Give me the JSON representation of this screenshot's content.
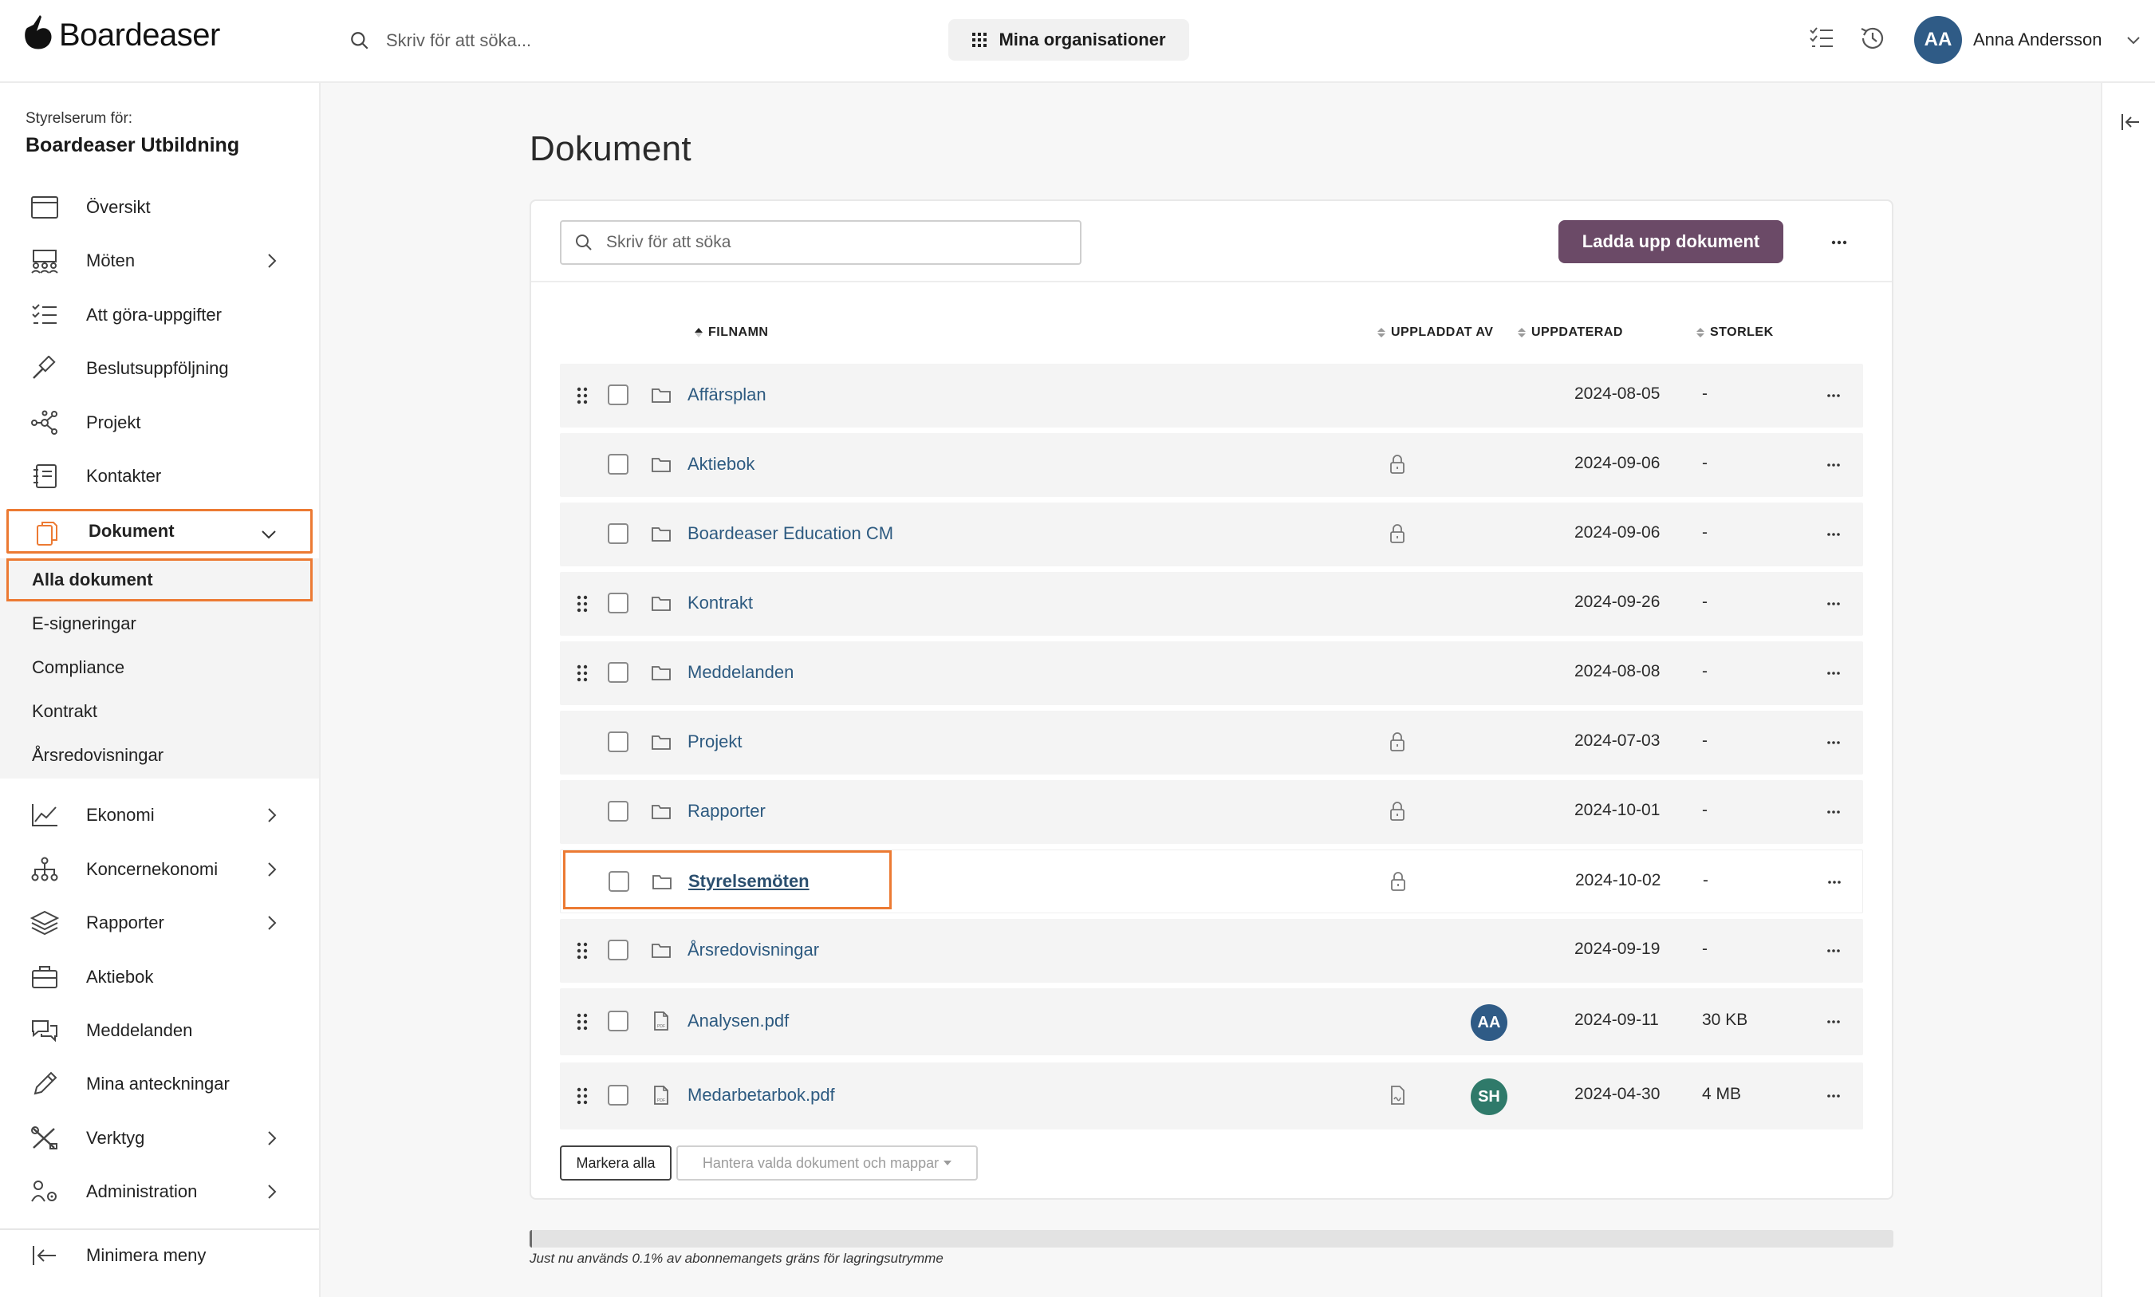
{
  "app": {
    "name": "Boardeaser"
  },
  "topbar": {
    "search_placeholder": "Skriv för att söka...",
    "org_button": "Mina organisationer",
    "user_initials": "AA",
    "user_name": "Anna Andersson"
  },
  "sidebar": {
    "room_label": "Styrelserum för:",
    "room_name": "Boardeaser Utbildning",
    "items": [
      {
        "label": "Översikt",
        "icon": "calendar-icon"
      },
      {
        "label": "Möten",
        "icon": "meeting-icon"
      },
      {
        "label": "Att göra-uppgifter",
        "icon": "checklist-icon"
      },
      {
        "label": "Beslutsuppföljning",
        "icon": "gavel-icon"
      },
      {
        "label": "Projekt",
        "icon": "network-icon"
      },
      {
        "label": "Kontakter",
        "icon": "contacts-icon"
      },
      {
        "label": "Dokument",
        "icon": "documents-icon"
      },
      {
        "label": "Ekonomi",
        "icon": "chart-icon"
      },
      {
        "label": "Koncernekonomi",
        "icon": "hierarchy-icon"
      },
      {
        "label": "Rapporter",
        "icon": "layers-icon"
      },
      {
        "label": "Aktiebok",
        "icon": "briefcase-icon"
      },
      {
        "label": "Meddelanden",
        "icon": "chat-icon"
      },
      {
        "label": "Mina anteckningar",
        "icon": "pencil-icon"
      },
      {
        "label": "Verktyg",
        "icon": "tools-icon"
      },
      {
        "label": "Administration",
        "icon": "users-gear-icon"
      }
    ],
    "submenu": [
      "Alla dokument",
      "E-signeringar",
      "Compliance",
      "Kontrakt",
      "Årsredovisningar"
    ],
    "minimize": "Minimera meny"
  },
  "main": {
    "title": "Dokument",
    "search_placeholder": "Skriv för att söka",
    "upload_button": "Ladda upp dokument",
    "columns": {
      "name": "FILNAMN",
      "uploaded_by": "UPPLADDAT AV",
      "updated": "UPPDATERAD",
      "size": "STORLEK"
    },
    "rows": [
      {
        "name": "Affärsplan",
        "type": "folder",
        "draggable": true,
        "locked": false,
        "updated": "2024-08-05",
        "size": "-"
      },
      {
        "name": "Aktiebok",
        "type": "folder",
        "draggable": false,
        "locked": true,
        "updated": "2024-09-06",
        "size": "-"
      },
      {
        "name": "Boardeaser Education CM",
        "type": "folder",
        "draggable": false,
        "locked": true,
        "updated": "2024-09-06",
        "size": "-"
      },
      {
        "name": "Kontrakt",
        "type": "folder",
        "draggable": true,
        "locked": false,
        "updated": "2024-09-26",
        "size": "-"
      },
      {
        "name": "Meddelanden",
        "type": "folder",
        "draggable": true,
        "locked": false,
        "updated": "2024-08-08",
        "size": "-"
      },
      {
        "name": "Projekt",
        "type": "folder",
        "draggable": false,
        "locked": true,
        "updated": "2024-07-03",
        "size": "-"
      },
      {
        "name": "Rapporter",
        "type": "folder",
        "draggable": false,
        "locked": true,
        "updated": "2024-10-01",
        "size": "-"
      },
      {
        "name": "Styrelsemöten",
        "type": "folder",
        "draggable": false,
        "locked": true,
        "updated": "2024-10-02",
        "size": "-",
        "hovered": true
      },
      {
        "name": "Årsredovisningar",
        "type": "folder",
        "draggable": true,
        "locked": false,
        "updated": "2024-09-19",
        "size": "-"
      },
      {
        "name": "Analysen.pdf",
        "type": "pdf",
        "draggable": true,
        "locked": false,
        "uploader": "AA",
        "uploader_color": "#2f5b86",
        "updated": "2024-09-11",
        "size": "30 KB"
      },
      {
        "name": "Medarbetarbok.pdf",
        "type": "pdf",
        "draggable": true,
        "locked": false,
        "signed": true,
        "uploader": "SH",
        "uploader_color": "#2f7a6a",
        "updated": "2024-04-30",
        "size": "4 MB"
      }
    ],
    "mark_all": "Markera alla",
    "manage_selected": "Hantera valda dokument och mappar",
    "storage_used_fraction": 0.001,
    "storage_text": "Just nu används 0.1% av abonnemangets gräns för lagringsutrymme"
  },
  "colors": {
    "accent": "#6b4a67",
    "highlight": "#ec7a33",
    "link": "#2d5a80"
  }
}
